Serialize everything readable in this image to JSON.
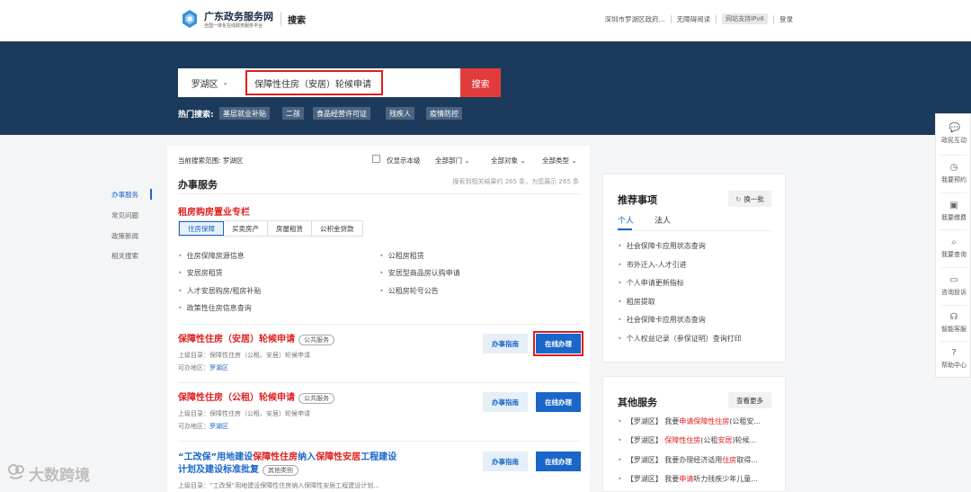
{
  "header": {
    "site_title": "广东政务服务网",
    "site_subtitle": "全国一体化在线政务服务平台",
    "page_tag": "搜索",
    "location": "深圳市罗湖区政府...",
    "accessibility": "无障碍阅读",
    "ipv6": "网站支持IPv6",
    "login": "登录"
  },
  "search": {
    "region": "罗湖区",
    "query": "保障性住房（安居）轮候申请",
    "button": "搜索",
    "hot_label": "热门搜索:",
    "hot_tags": [
      "基层就业补贴",
      "二孩",
      "食品经营许可证",
      "残疾人",
      "疫情防控"
    ]
  },
  "leftnav": [
    "办事服务",
    "常见问题",
    "政策新闻",
    "相关搜索"
  ],
  "filters": {
    "scope": "当前搜索范围:  罗湖区",
    "only_level": "仅显示本级",
    "dept": "全部部门",
    "object": "全部对象",
    "type": "全部类型"
  },
  "main": {
    "section_title": "办事服务",
    "result_count": "搜索到相关结果约 265 条，为您展示 265 条",
    "column_title": "租房购房置业专栏",
    "subtabs": [
      "住房保障",
      "买卖房产",
      "房屋租赁",
      "公积金贷款"
    ],
    "links_left": [
      "住房保障房源信息",
      "安居房租赁",
      "人才安居购房/租房补贴",
      "政策性住房信息查询"
    ],
    "links_right": [
      "公租房租赁",
      "安居型商品房认购申请",
      "公租房轮号公告"
    ],
    "services": [
      {
        "title_parts": [
          {
            "t": "保障性",
            "c": "r"
          },
          {
            "t": "住房",
            "c": "r"
          },
          {
            "t": "（安居）",
            "c": "r"
          },
          {
            "t": "轮候",
            "c": "r"
          },
          {
            "t": "申请",
            "c": "r"
          }
        ],
        "badge": "公共服务",
        "parent": "上级目录：保障性住房（公租、安居）轮候申请",
        "area_label": "可办地区：",
        "area": "罗湖区",
        "guide": "办事指南",
        "do": "在线办理"
      },
      {
        "title_parts": [
          {
            "t": "保障性",
            "c": "r"
          },
          {
            "t": "住房",
            "c": "r"
          },
          {
            "t": "（公租）",
            "c": "r"
          },
          {
            "t": "轮候",
            "c": "r"
          },
          {
            "t": "申请",
            "c": "r"
          }
        ],
        "badge": "公共服务",
        "parent": "上级目录：保障性住房（公租、安居）轮候申请",
        "area_label": "可办地区：",
        "area": "罗湖区",
        "guide": "办事指南",
        "do": "在线办理"
      },
      {
        "title_line1": [
          {
            "t": "“工改保”用地建设",
            "c": "b"
          },
          {
            "t": "保障性",
            "c": "r"
          },
          {
            "t": "住房",
            "c": "r"
          },
          {
            "t": "纳入",
            "c": "b"
          },
          {
            "t": "保障性",
            "c": "r"
          },
          {
            "t": "安居",
            "c": "r"
          },
          {
            "t": "工程建设",
            "c": "b"
          }
        ],
        "title_line2": "计划及建设标准批复",
        "badge": "其他类别",
        "parent": "上级目录：“工改保”用地建设保障性住房纳入保障性安居工程建设计划...",
        "guide": "办事指南",
        "do": "在线办理"
      }
    ]
  },
  "recommend": {
    "title": "推荐事项",
    "refresh": "换一批",
    "tabs": [
      "个人",
      "法人"
    ],
    "items": [
      "社会保障卡应用状态查询",
      "市外迁入-人才引进",
      "个人申请更新指标",
      "租房提取",
      "社会保障卡应用状态查询",
      "个人权益记录（参保证明）查询打印"
    ]
  },
  "others": {
    "title": "其他服务",
    "more": "查看更多",
    "items": [
      [
        {
          "t": "【罗湖区】 我要",
          "c": ""
        },
        {
          "t": "申请保障性住房",
          "c": "r"
        },
        {
          "t": "(公租安...",
          "c": ""
        }
      ],
      [
        {
          "t": "【罗湖区】 ",
          "c": ""
        },
        {
          "t": "保障性住房",
          "c": "r"
        },
        {
          "t": "(公租",
          "c": ""
        },
        {
          "t": "安居",
          "c": "r"
        },
        {
          "t": ")轮候...",
          "c": ""
        }
      ],
      [
        {
          "t": "【罗湖区】 我要办理经济适用",
          "c": ""
        },
        {
          "t": "住房",
          "c": "r"
        },
        {
          "t": "取得...",
          "c": ""
        }
      ],
      [
        {
          "t": "【罗湖区】 我要",
          "c": ""
        },
        {
          "t": "申请",
          "c": "r"
        },
        {
          "t": "听力残疾少年儿童...",
          "c": ""
        }
      ]
    ]
  },
  "floatbar": [
    "政民互动",
    "我要预约",
    "我要缴费",
    "我要查询",
    "咨询投诉",
    "智能客服",
    "帮助中心"
  ],
  "watermark": "大数跨境"
}
